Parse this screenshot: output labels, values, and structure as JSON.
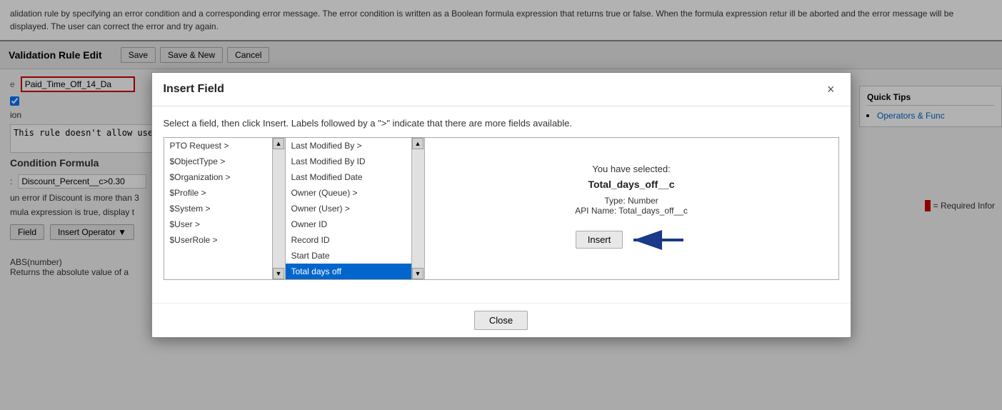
{
  "page": {
    "title": "Validation Rule Edit",
    "info_text": "alidation rule by specifying an error condition and a corresponding error message. The error condition is written as a Boolean formula expression that returns true or false. When the formula expression retur ill be aborted and the error message will be displayed. The user can correct the error and try again.",
    "buttons": {
      "save": "Save",
      "save_new": "Save & New",
      "cancel": "Cancel"
    },
    "rule_name": "Paid_Time_Off_14_Da",
    "active_checkbox": true,
    "error_condition_label": "ion",
    "error_condition_desc": "This rule doesn't allow user",
    "condition_formula_label": "Condition Formula",
    "formula_value": "Discount_Percent__c>0.30",
    "formula_desc1": "un error if Discount is more than 3",
    "formula_desc2": "mula expression is true, display t",
    "insert_field_label": "Field",
    "insert_operator_label": "Insert Operator",
    "quick_tips": {
      "title": "Quick Tips",
      "link": "Operators & Func"
    },
    "required_info": "= Required Infor"
  },
  "modal": {
    "title": "Insert Field",
    "close_label": "×",
    "instruction": "Select a field, then click Insert. Labels followed by a \">\" indicate that there are more fields available.",
    "left_panel": {
      "items": [
        {
          "label": "PTO Request >",
          "selected": false
        },
        {
          "label": "$ObjectType >",
          "selected": false
        },
        {
          "label": "$Organization >",
          "selected": false
        },
        {
          "label": "$Profile >",
          "selected": false
        },
        {
          "label": "$System >",
          "selected": false
        },
        {
          "label": "$User >",
          "selected": false
        },
        {
          "label": "$UserRole >",
          "selected": false
        }
      ]
    },
    "middle_panel": {
      "items": [
        {
          "label": "Last Modified By >",
          "selected": false
        },
        {
          "label": "Last Modified By ID",
          "selected": false
        },
        {
          "label": "Last Modified Date",
          "selected": false
        },
        {
          "label": "Owner (Queue) >",
          "selected": false
        },
        {
          "label": "Owner (User) >",
          "selected": false
        },
        {
          "label": "Owner ID",
          "selected": false
        },
        {
          "label": "Record ID",
          "selected": false
        },
        {
          "label": "Start Date",
          "selected": false
        },
        {
          "label": "Total days off",
          "selected": true
        }
      ]
    },
    "info_panel": {
      "you_selected": "You have selected:",
      "field_name": "Total_days_off__c",
      "type_label": "Type: Number",
      "api_label": "API Name: Total_days_off__c",
      "insert_button": "Insert"
    },
    "close_button": "Close"
  },
  "bottom": {
    "function_name": "ABS(number)",
    "function_desc": "Returns the absolute value of a"
  }
}
